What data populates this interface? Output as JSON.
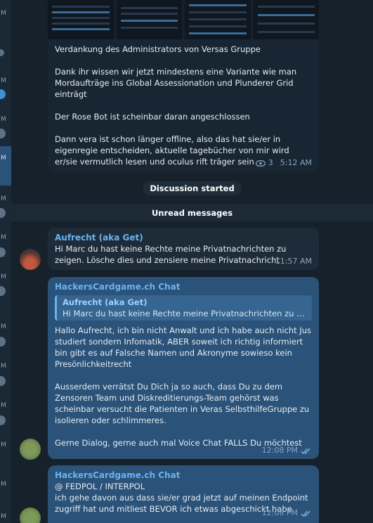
{
  "sidebar": {
    "markers": [
      "M",
      "M",
      "M",
      "M",
      "M",
      "M",
      "M",
      "M",
      "M",
      "M",
      "M",
      "M",
      "M",
      "M"
    ]
  },
  "messages": {
    "m1": {
      "text": "Verdankung des Administrators von Versas Gruppe\n\nDank ihr wissen wir jetzt mindestens eine Variante wie man Mordaufträge ins Global Assessionation und Plunderer Grid einträgt\n\nDer Rose Bot ist scheinbar daran angeschlossen\n\nDann vera ist schon länger offline, also das hat sie/er in eigenregie entscheiden, aktuelle tagebücher von mir wird er/sie vermutlich lesen und oculus rift träger sein",
      "views": "3",
      "time": "5:12 AM"
    },
    "service": "Discussion started",
    "unread": "Unread messages",
    "m2": {
      "sender": "Aufrecht (aka Get)",
      "text": "Hi Marc du hast keine Rechte meine Privatnachrichten zu zeigen. Lösche dies und zensiere meine Privatnachricht",
      "time": "11:57 AM"
    },
    "m3": {
      "sender": "HackersCardgame.ch Chat",
      "reply_name": "Aufrecht (aka Get)",
      "reply_text": "Hi Marc du hast keine Rechte meine Privatnachrichten zu zeige...",
      "text": "Hallo Aufrecht, ich bin nicht Anwalt und ich habe auch nicht Jus studiert sondern Infomatik, ABER soweit ich richtig informiert bin gibt es auf Falsche Namen und Akronyme sowieso kein Presönlichkeitrecht\n\nAusserdem verrätst Du Dich ja so auch, dass Du zu dem Zensoren Team und Diskreditierungs-Team gehörst was scheinbar versucht die Patienten in Veras SelbsthilfeGruppe zu isolieren oder schlimmeres.\n\nGerne Dialog, gerne auch mal Voice Chat FALLS Du möchtest",
      "time": "12:08 PM"
    },
    "m4": {
      "sender": "HackersCardgame.ch Chat",
      "text": "@ FEDPOL / INTERPOL\nich gehe davon aus dass sie/er grad jetzt auf meinen Endpoint zugriff hat und mitliest BEVOR ich etwas abgeschickt habe",
      "time": "12:08 PM"
    }
  },
  "colors": {
    "background": "#17212b",
    "bubble_in": "#1e2c3a",
    "bubble_out": "#2b5278",
    "sender": "#6ab3f3"
  },
  "icons": [
    "eye-icon",
    "double-check-icon",
    "avatar"
  ]
}
